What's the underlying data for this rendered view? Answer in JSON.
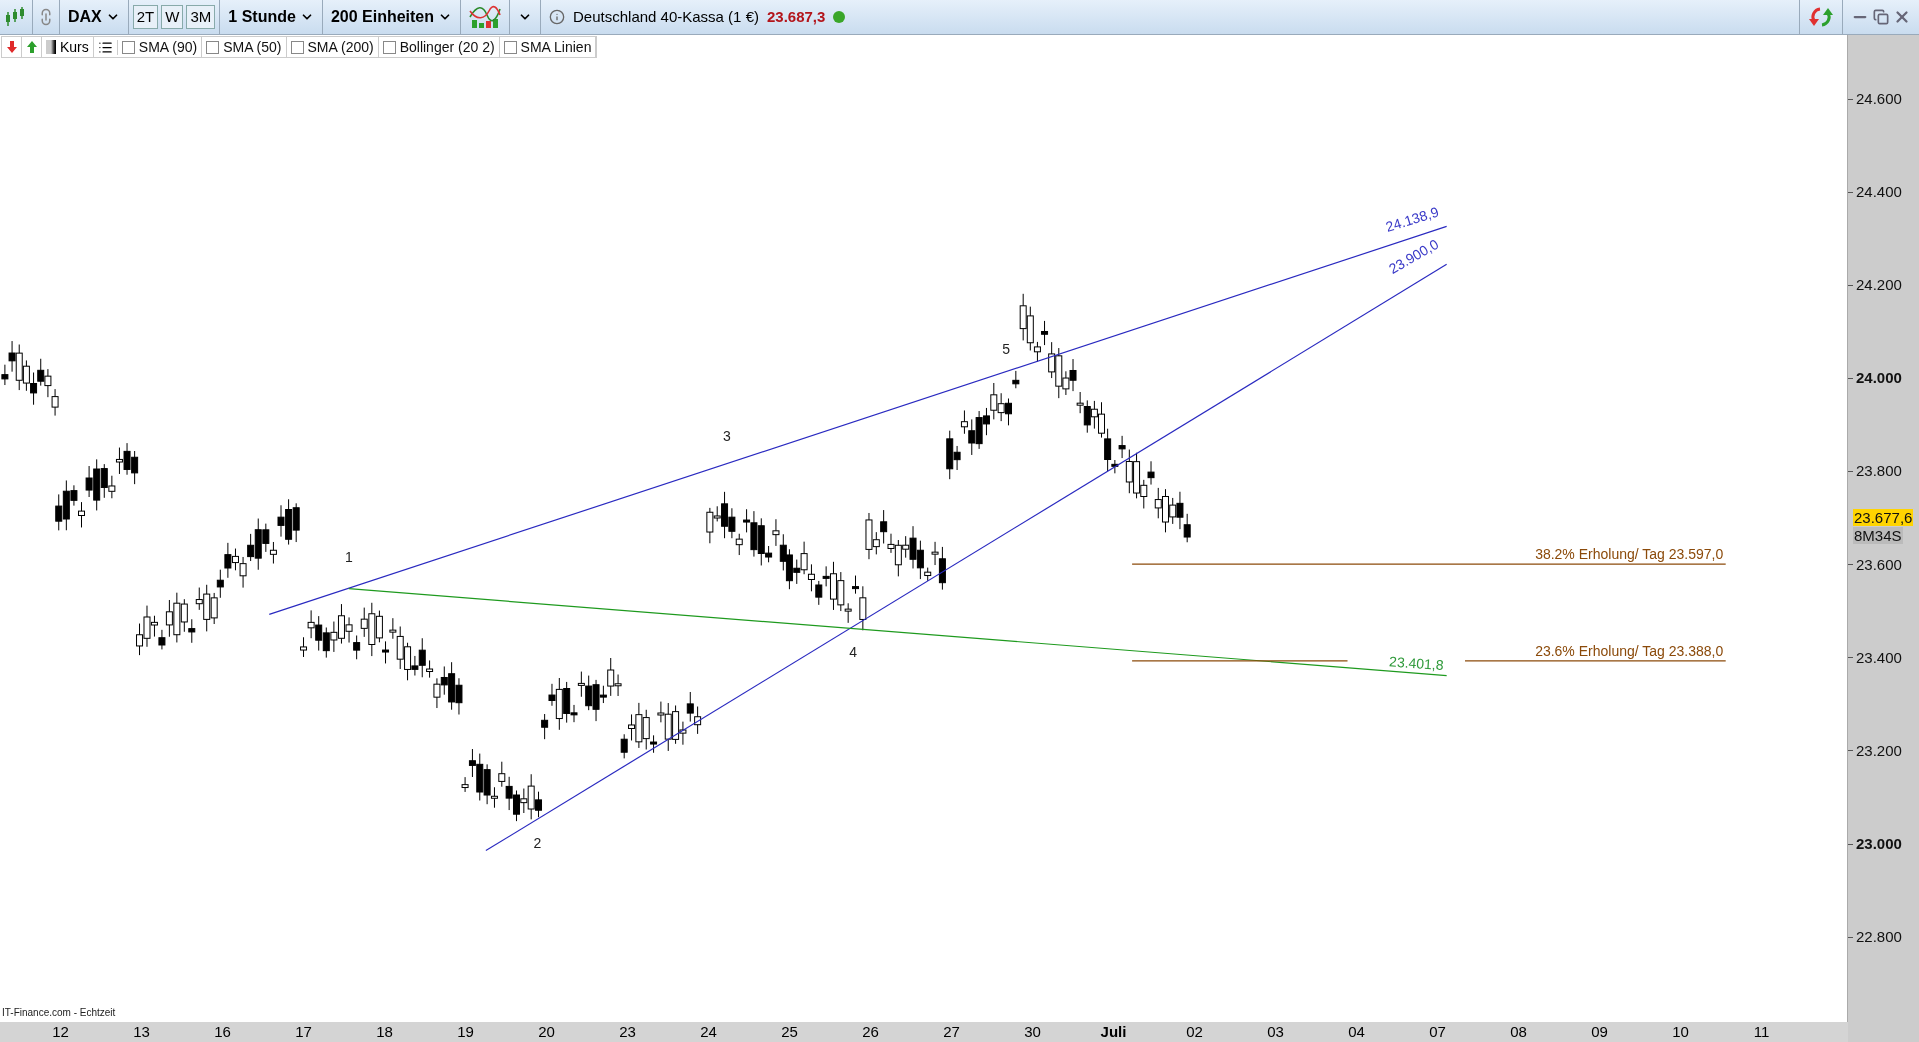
{
  "toolbar": {
    "symbol": "DAX",
    "periods": [
      {
        "label": "2T",
        "selected": false
      },
      {
        "label": "W",
        "selected": false
      },
      {
        "label": "3M",
        "selected": false
      }
    ],
    "interval": "1 Stunde",
    "units": "200 Einheiten",
    "instrument": "Deutschland 40-Kassa (1 €)",
    "price": "23.687,3",
    "live": true
  },
  "legend": {
    "price_label": "Kurs",
    "indicators": [
      {
        "label": "SMA (90)",
        "checked": false
      },
      {
        "label": "SMA (50)",
        "checked": false
      },
      {
        "label": "SMA (200)",
        "checked": false
      },
      {
        "label": "Bollinger (20 2)",
        "checked": false
      },
      {
        "label": "SMA Linien",
        "checked": false
      }
    ]
  },
  "chart": {
    "wave_labels": [
      "1",
      "2",
      "3",
      "4",
      "5"
    ],
    "line_labels": [
      {
        "text": "24.138,9",
        "kind": "upper"
      },
      {
        "text": "23.900,0",
        "kind": "lower"
      },
      {
        "text": "23.401,8",
        "kind": "green"
      }
    ],
    "levels": [
      {
        "text": "38.2% Erholung/ Tag 23.597,0"
      },
      {
        "text": "23.6% Erholung/ Tag 23.388,0"
      }
    ],
    "source": "IT-Finance.com - Echtzeit"
  },
  "price_axis": {
    "ticks": [
      {
        "label": "24.600",
        "major": false
      },
      {
        "label": "24.400",
        "major": false
      },
      {
        "label": "24.200",
        "major": false
      },
      {
        "label": "24.000",
        "major": true
      },
      {
        "label": "23.800",
        "major": false
      },
      {
        "label": "23.600",
        "major": false
      },
      {
        "label": "23.400",
        "major": false
      },
      {
        "label": "23.200",
        "major": false
      },
      {
        "label": "23.000",
        "major": true
      },
      {
        "label": "22.800",
        "major": false
      }
    ],
    "current": "23.677,6",
    "countdown": "8M34S"
  },
  "date_axis": [
    {
      "label": "12",
      "major": false
    },
    {
      "label": "13",
      "major": false
    },
    {
      "label": "16",
      "major": false
    },
    {
      "label": "17",
      "major": false
    },
    {
      "label": "18",
      "major": false
    },
    {
      "label": "19",
      "major": false
    },
    {
      "label": "20",
      "major": false
    },
    {
      "label": "23",
      "major": false
    },
    {
      "label": "24",
      "major": false
    },
    {
      "label": "25",
      "major": false
    },
    {
      "label": "26",
      "major": false
    },
    {
      "label": "27",
      "major": false
    },
    {
      "label": "30",
      "major": false
    },
    {
      "label": "Juli",
      "major": true
    },
    {
      "label": "02",
      "major": false
    },
    {
      "label": "03",
      "major": false
    },
    {
      "label": "04",
      "major": false
    },
    {
      "label": "07",
      "major": false
    },
    {
      "label": "08",
      "major": false
    },
    {
      "label": "09",
      "major": false
    },
    {
      "label": "10",
      "major": false
    },
    {
      "label": "11",
      "major": false
    }
  ]
}
